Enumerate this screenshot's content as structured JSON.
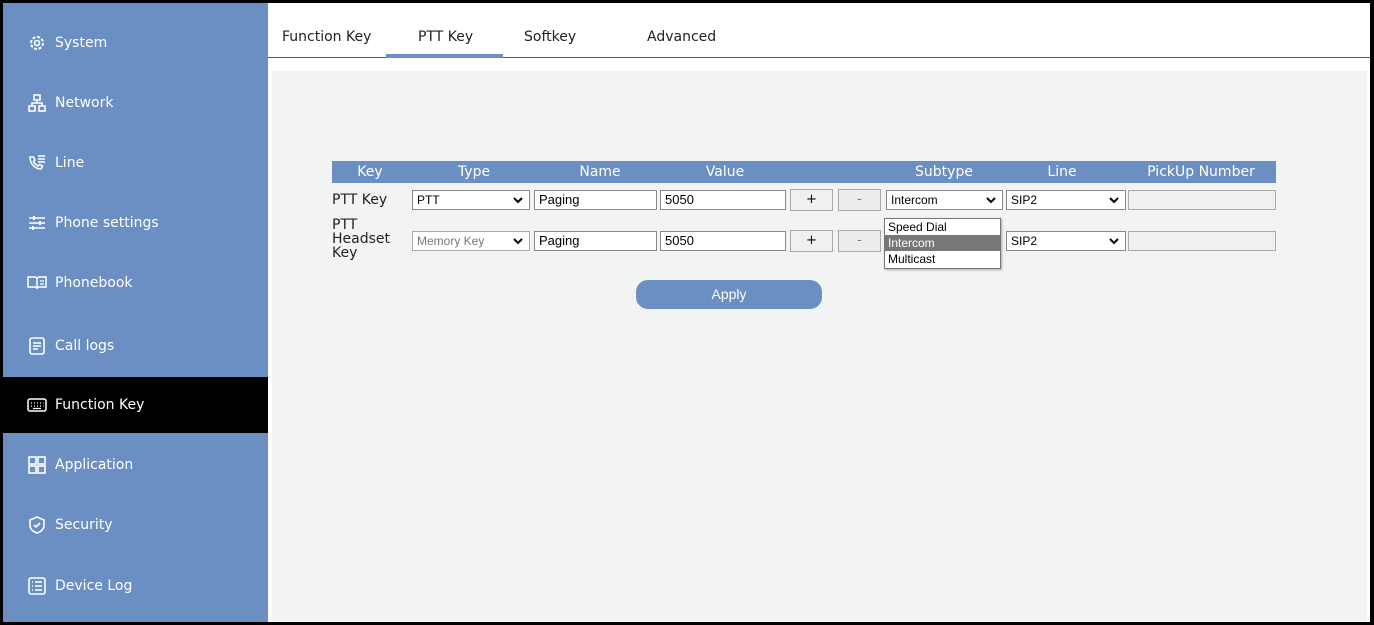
{
  "sidebar": {
    "items": [
      {
        "label": "System",
        "icon": "gear-icon"
      },
      {
        "label": "Network",
        "icon": "network-icon"
      },
      {
        "label": "Line",
        "icon": "phone-lines-icon"
      },
      {
        "label": "Phone settings",
        "icon": "sliders-icon"
      },
      {
        "label": "Phonebook",
        "icon": "book-icon"
      },
      {
        "label": "Call logs",
        "icon": "document-icon"
      },
      {
        "label": "Function Key",
        "icon": "keyboard-icon",
        "active": true
      },
      {
        "label": "Application",
        "icon": "grid-icon"
      },
      {
        "label": "Security",
        "icon": "shield-icon"
      },
      {
        "label": "Device Log",
        "icon": "list-icon"
      }
    ]
  },
  "tabs": [
    {
      "label": "Function Key"
    },
    {
      "label": "PTT Key",
      "active": true
    },
    {
      "label": "Softkey"
    },
    {
      "label": "Advanced"
    }
  ],
  "table": {
    "headers": [
      "Key",
      "Type",
      "Name",
      "Value",
      "Subtype",
      "Line",
      "PickUp Number"
    ],
    "rows": [
      {
        "key_lines": [
          "PTT Key"
        ],
        "type": "PTT",
        "type_disabled": false,
        "name": "Paging",
        "value": "5050",
        "plus": "+",
        "minus": "-",
        "subtype": "Intercom",
        "line": "SIP2",
        "pickup": ""
      },
      {
        "key_lines": [
          "PTT",
          "Headset",
          "Key"
        ],
        "type": "Memory Key",
        "type_disabled": true,
        "name": "Paging",
        "value": "5050",
        "plus": "+",
        "minus": "-",
        "subtype": "Intercom",
        "line": "SIP2",
        "pickup": ""
      }
    ]
  },
  "subtype_dropdown": {
    "options": [
      "Speed Dial",
      "Intercom",
      "Multicast"
    ],
    "selected": "Intercom"
  },
  "apply_label": "Apply",
  "colors": {
    "accent": "#6b8fc2",
    "sidebar_active": "#000000",
    "content_bg": "#f2f3f3"
  }
}
